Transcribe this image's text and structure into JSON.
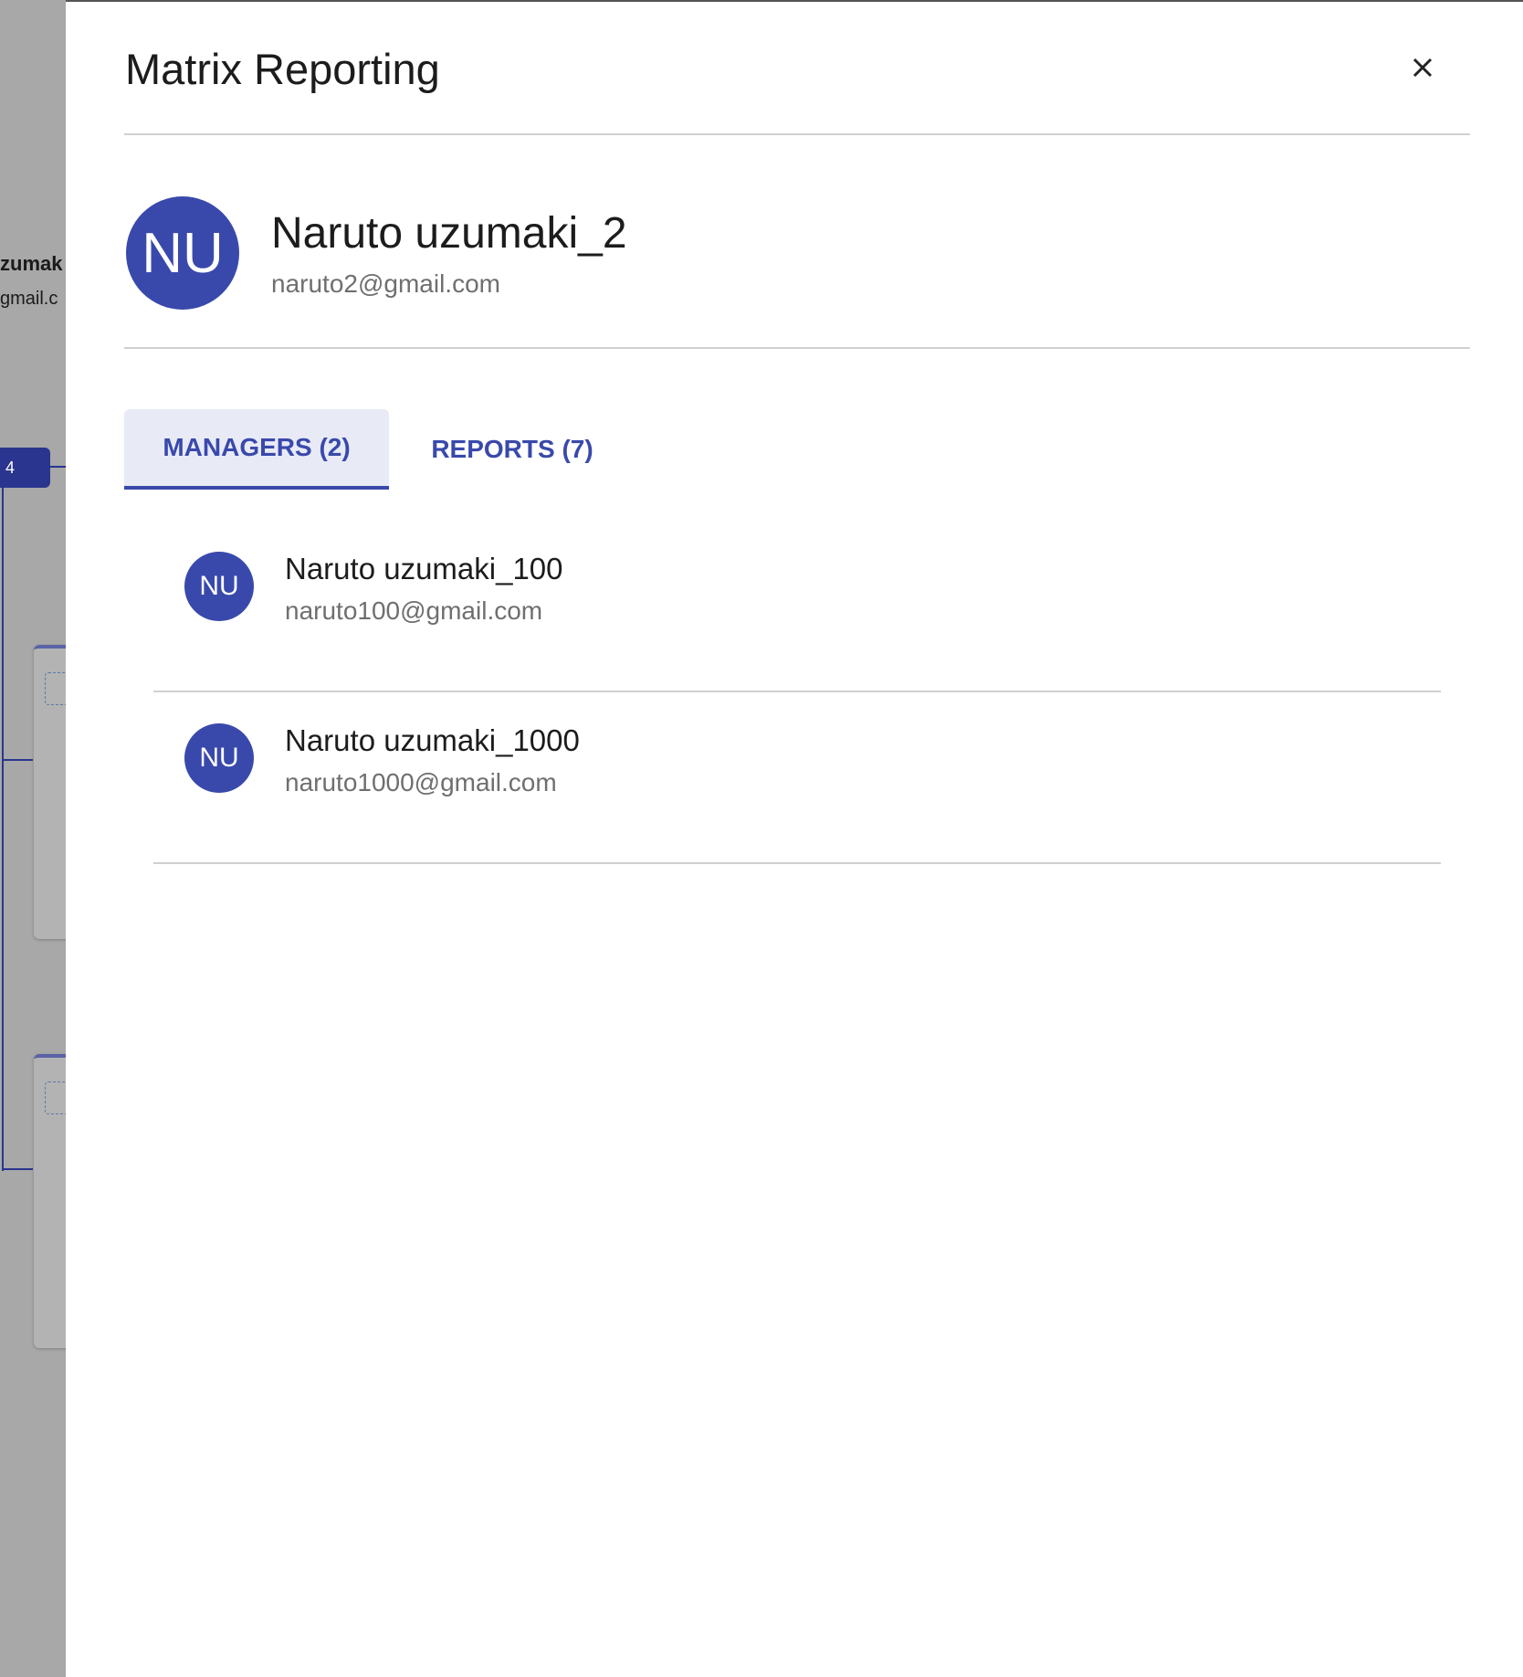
{
  "background": {
    "partial_name": "zumak",
    "partial_email": "gmail.c",
    "badge_count": "4"
  },
  "drawer": {
    "title": "Matrix Reporting",
    "close_icon": "close-icon",
    "employee": {
      "initials": "NU",
      "name": "Naruto uzumaki_2",
      "email": "naruto2@gmail.com"
    },
    "tabs": [
      {
        "label": "MANAGERS (2)",
        "active": true
      },
      {
        "label": "REPORTS (7)",
        "active": false
      }
    ],
    "list": [
      {
        "initials": "NU",
        "name": "Naruto uzumaki_100",
        "email": "naruto100@gmail.com"
      },
      {
        "initials": "NU",
        "name": "Naruto uzumaki_1000",
        "email": "naruto1000@gmail.com"
      }
    ]
  },
  "colors": {
    "primary": "#3949ab",
    "tab_active_bg": "#e8eaf6",
    "divider": "#d0d0d0",
    "overlay": "#a8a8a8"
  }
}
